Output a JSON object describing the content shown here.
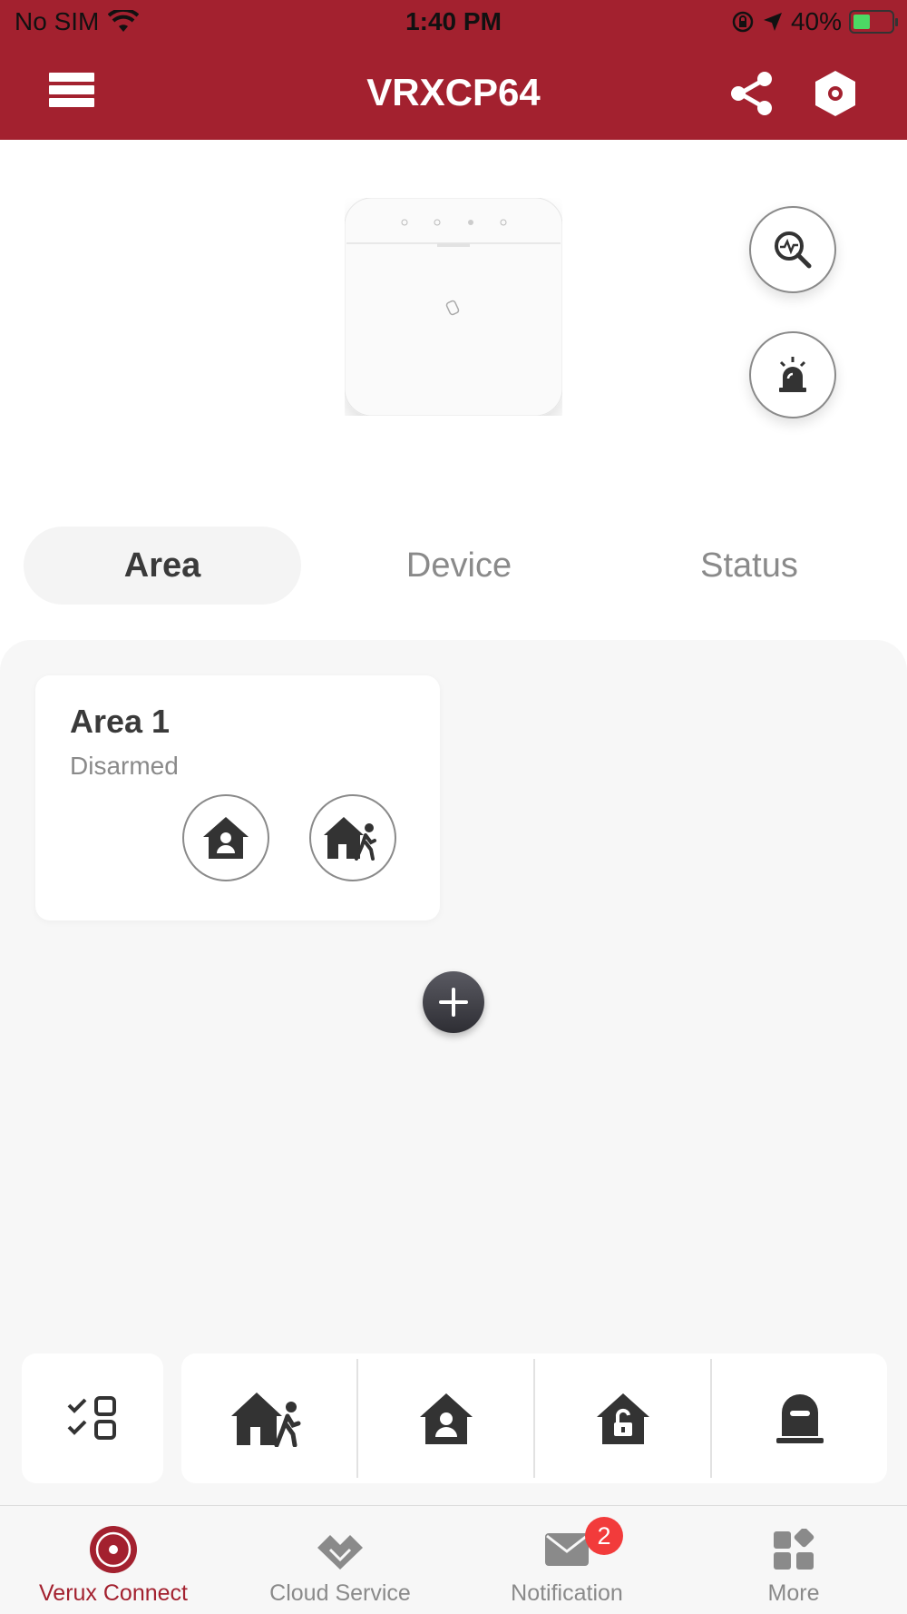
{
  "status_bar": {
    "carrier": "No SIM",
    "time": "1:40 PM",
    "battery": "40%"
  },
  "header": {
    "title": "VRXCP64",
    "menu_icon": "menu-icon",
    "share_icon": "share-icon",
    "settings_icon": "gear-icon"
  },
  "tabs": [
    {
      "label": "Area",
      "active": true
    },
    {
      "label": "Device",
      "active": false
    },
    {
      "label": "Status",
      "active": false
    }
  ],
  "areas": [
    {
      "name": "Area 1",
      "status": "Disarmed"
    }
  ],
  "action_bar": {
    "select_icon": "multi-select-icon",
    "actions": [
      "away-arm-icon",
      "stay-arm-icon",
      "disarm-icon",
      "clear-alarm-icon"
    ]
  },
  "bottom_nav": [
    {
      "label": "Verux Connect",
      "icon": "verux-connect-icon",
      "active": true
    },
    {
      "label": "Cloud Service",
      "icon": "cloud-service-icon",
      "active": false
    },
    {
      "label": "Notification",
      "icon": "mail-icon",
      "active": false,
      "badge": "2"
    },
    {
      "label": "More",
      "icon": "grid-icon",
      "active": false
    }
  ],
  "colors": {
    "brand": "#a3212f",
    "badge": "#f23b3b",
    "battery_charge": "#4cd964"
  }
}
